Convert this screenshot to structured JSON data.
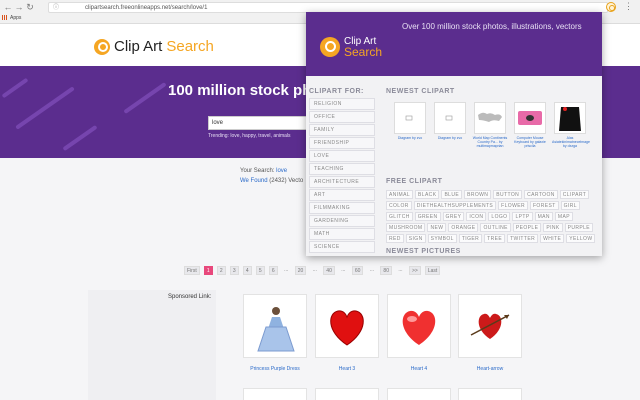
{
  "browser": {
    "url": "clipartsearch.freeonlineapps.net/search/love/1",
    "bookmarks_label": "Apps"
  },
  "site": {
    "logo_word1": "Clip Art",
    "logo_word2": "Search"
  },
  "hero": {
    "title": "100 million stock pho",
    "search_value": "love",
    "trending": "Trending: love, happy, travel, animals"
  },
  "results": {
    "your_search_label": "Your Search:",
    "your_search_value": "love",
    "found_label": "We Found",
    "found_value": "(2432) Vecto"
  },
  "pagination": [
    "First",
    "1",
    "2",
    "3",
    "4",
    "5",
    "6",
    "...",
    "20",
    "...",
    "40",
    "...",
    "60",
    "...",
    "80",
    "...",
    ">>",
    "Last"
  ],
  "pagination_active": "1",
  "sponsored": "Sponsored Link:",
  "clips": [
    {
      "name": "Princess Purple Dress"
    },
    {
      "name": "Heart 3"
    },
    {
      "name": "Heart 4"
    },
    {
      "name": "Heart-arrow"
    }
  ],
  "popup": {
    "logo_word1": "Clip Art",
    "logo_word2": "Search",
    "tagline": "Over 100 million stock photos, illustrations, vectors",
    "side_title": "CLIPART FOR:",
    "side_items": [
      "RELIGION",
      "OFFICE",
      "FAMILY",
      "FRIENDSHIP",
      "LOVE",
      "TEACHING",
      "ARCHITECTURE",
      "ART",
      "FILMMAKING",
      "GARDENING",
      "MATH",
      "SCIENCE"
    ],
    "newest_clipart_title": "NEWEST CLIPART",
    "newest_clipart": [
      {
        "name": "Diagram by zvo"
      },
      {
        "name": "Diagram by zvo"
      },
      {
        "name": "World Map Continents Country Pa... by multimapmaprian"
      },
      {
        "name": "Computer Mouse Keyboard by galaxie priscila"
      },
      {
        "name": "Alas Asiatekinimatnecelmage by dxzga"
      }
    ],
    "free_clipart_title": "FREE CLIPART",
    "tags": [
      "ANIMAL",
      "BLACK",
      "BLUE",
      "BROWN",
      "BUTTON",
      "CARTOON",
      "CLIPART",
      "COLOR",
      "DIETHEALTHSUPPLEMENTS",
      "FLOWER",
      "FOREST",
      "GIRL",
      "GLITCH",
      "GREEN",
      "GREY",
      "ICON",
      "LOGO",
      "LPTP",
      "MAN",
      "MAP",
      "MUSHROOM",
      "NEW",
      "ORANGE",
      "OUTLINE",
      "PEOPLE",
      "PINK",
      "PURPLE",
      "RED",
      "SIGN",
      "SYMBOL",
      "TIGER",
      "TREE",
      "TWITTER",
      "WHITE",
      "YELLOW"
    ],
    "newest_pictures_title": "NEWEST PICTURES"
  },
  "colors": {
    "brand_purple": "#5b2d8e",
    "brand_orange": "#f5a623",
    "link_blue": "#2a6ac9",
    "active_page": "#e8487c"
  }
}
